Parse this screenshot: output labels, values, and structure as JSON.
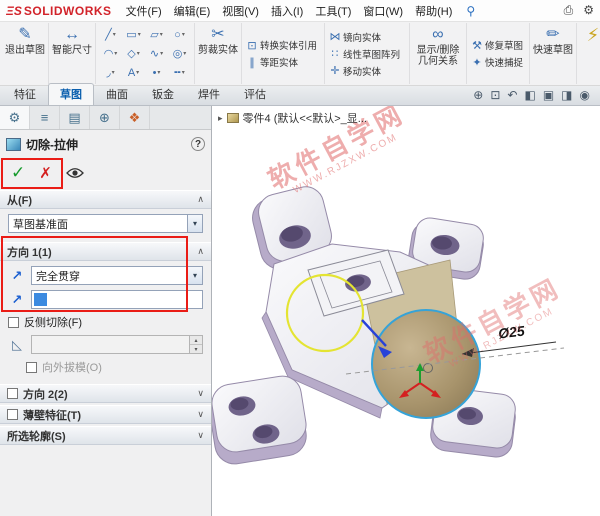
{
  "colors": {
    "brand_red": "#d2232a",
    "annotation_red": "#ea1c16",
    "accent_blue": "#1a6fc4",
    "selection_blue": "#3b8ae0",
    "highlight_yellow": "#e4e432",
    "model_lavender": "#b7abc9",
    "model_hole_purple": "#70648a",
    "cylinder_tan": "#a8946c",
    "watermark_pink": "#e06a6a"
  },
  "menu_bar": {
    "logo_mark": "ΞS",
    "logo_text": "SOLIDWORKS",
    "items": [
      "文件(F)",
      "编辑(E)",
      "视图(V)",
      "插入(I)",
      "工具(T)",
      "窗口(W)",
      "帮助(H)"
    ]
  },
  "icons": {
    "pin": "⚲",
    "print": "⎙",
    "gear": "⚙",
    "combo_arrow": "▾",
    "chevron_up": "∧",
    "chevron_down": "∨",
    "check": "✓",
    "cancel": "✗",
    "help": "?",
    "reverse_direction": "↗",
    "draft": "◺",
    "spinner_up": "▴",
    "spinner_down": "▾",
    "flyout_arrow": "▸",
    "instant2d": "⚡"
  },
  "ribbon": {
    "exit_sketch": "退出草图",
    "smart_dimension": "智能尺寸",
    "trim": "剪裁实体",
    "convert": "转换实体引用",
    "offset": "等距实体",
    "mirror": "镜向实体",
    "linear_pattern": "线性草图阵列",
    "move": "移动实体",
    "display_relations": "显示/删除几何关系",
    "repair": "修复草图",
    "quick_snaps": "快速捕捉",
    "rapid_sketch": "快速草图",
    "glyphs": {
      "exit_sketch": "✎",
      "smart_dimension": "↔",
      "trim": "✂",
      "convert": "⊡",
      "offset": "∥",
      "mirror": "⋈",
      "linear_pattern": "∷",
      "move": "✛",
      "display_relations": "∞",
      "repair": "⚒",
      "quick_snaps": "✦",
      "rapid_sketch": "✏"
    },
    "sketch_tools": [
      {
        "name": "line-icon",
        "glyph": "╱"
      },
      {
        "name": "rectangle-icon",
        "glyph": "▭"
      },
      {
        "name": "slot-icon",
        "glyph": "▱"
      },
      {
        "name": "circle-icon",
        "glyph": "○"
      },
      {
        "name": "arc-icon",
        "glyph": "◠"
      },
      {
        "name": "polygon-icon",
        "glyph": "◇"
      },
      {
        "name": "spline-icon",
        "glyph": "∿"
      },
      {
        "name": "ellipse-icon",
        "glyph": "◎"
      },
      {
        "name": "fillet-icon",
        "glyph": "◞"
      },
      {
        "name": "text-icon",
        "glyph": "A"
      },
      {
        "name": "point-icon",
        "glyph": "•"
      },
      {
        "name": "centerline-icon",
        "glyph": "╍"
      }
    ]
  },
  "tabs": [
    {
      "label": "特征",
      "active": false
    },
    {
      "label": "草图",
      "active": true
    },
    {
      "label": "曲面",
      "active": false
    },
    {
      "label": "钣金",
      "active": false
    },
    {
      "label": "焊件",
      "active": false
    },
    {
      "label": "评估",
      "active": false
    }
  ],
  "view_toolbar": [
    {
      "name": "zoom-fit-icon",
      "glyph": "⊕"
    },
    {
      "name": "zoom-area-icon",
      "glyph": "⊡"
    },
    {
      "name": "previous-view-icon",
      "glyph": "↶"
    },
    {
      "name": "section-view-icon",
      "glyph": "◧"
    },
    {
      "name": "view-orientation-icon",
      "glyph": "▣"
    },
    {
      "name": "display-style-icon",
      "glyph": "◨"
    },
    {
      "name": "hide-show-icon",
      "glyph": "◉"
    }
  ],
  "property_manager": {
    "tabs": [
      {
        "name": "property-manager-tab",
        "glyph": "⚙",
        "active": true,
        "color": "#46708c"
      },
      {
        "name": "feature-tree-tab",
        "glyph": "≡",
        "active": false,
        "color": "#46708c"
      },
      {
        "name": "configuration-tab",
        "glyph": "▤",
        "active": false,
        "color": "#46708c"
      },
      {
        "name": "dimxpert-tab",
        "glyph": "⊕",
        "active": false,
        "color": "#46708c"
      },
      {
        "name": "display-manager-tab",
        "glyph": "❖",
        "active": false,
        "color": "#c95f28"
      }
    ],
    "title": "切除-拉伸",
    "from": {
      "header": "从(F)",
      "value": "草图基准面"
    },
    "direction1": {
      "header": "方向 1(1)",
      "end_condition": "完全贯穿",
      "flip_side": "反侧切除(F)",
      "draft_value": "",
      "outward_draft": "向外拔模(O)"
    },
    "direction2": {
      "header": "方向 2(2)"
    },
    "thin_feature": {
      "header": "薄壁特征(T)"
    },
    "selected_contours": {
      "header": "所选轮廓(S)"
    }
  },
  "graphics": {
    "breadcrumb": "零件4 (默认<<默认>_显...",
    "dimension_label": "Ø25",
    "watermark": {
      "line1": "软件自学网",
      "line2": "WWW.RJZXW.COM"
    }
  }
}
